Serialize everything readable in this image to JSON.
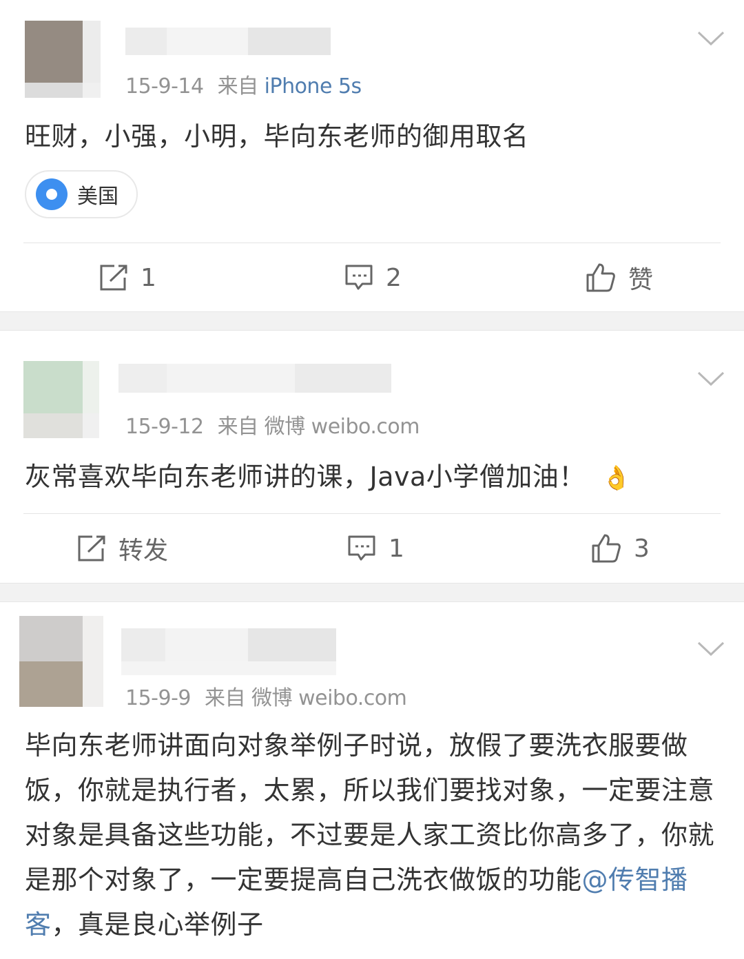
{
  "posts": [
    {
      "date": "15-9-14",
      "source_prefix": "来自",
      "source": "iPhone 5s",
      "text": "旺财，小强，小明，毕向东老师的御用取名",
      "location": "美国",
      "actions": {
        "repost": "1",
        "comment": "2",
        "like": "赞"
      }
    },
    {
      "date": "15-9-12",
      "source_prefix": "来自",
      "source": "微博 weibo.com",
      "text": "灰常喜欢毕向东老师讲的课，Java小学僧加油！",
      "emoji": "👌",
      "actions": {
        "repost": "转发",
        "comment": "1",
        "like": "3"
      }
    },
    {
      "date": "15-9-9",
      "source_prefix": "来自",
      "source": "微博 weibo.com",
      "text_before": "毕向东老师讲面向对象举例子时说，放假了要洗衣服要做饭，你就是执行者，太累，所以我们要找对象，一定要注意对象是具备这些功能，不过要是人家工资比你高多了，你就是那个对象了，一定要提高自己洗衣做饭的功能",
      "mention": "@传智播客",
      "text_after": "，真是良心举例子"
    }
  ],
  "colors": {
    "link": "#507daf",
    "meta": "#939393",
    "location_pin": "#3d8ff0",
    "separator": "#f2f2f2"
  },
  "icons": [
    "chevron-down-icon",
    "location-pin-icon",
    "repost-icon",
    "comment-icon",
    "like-icon",
    "ok-hand-emoji"
  ]
}
